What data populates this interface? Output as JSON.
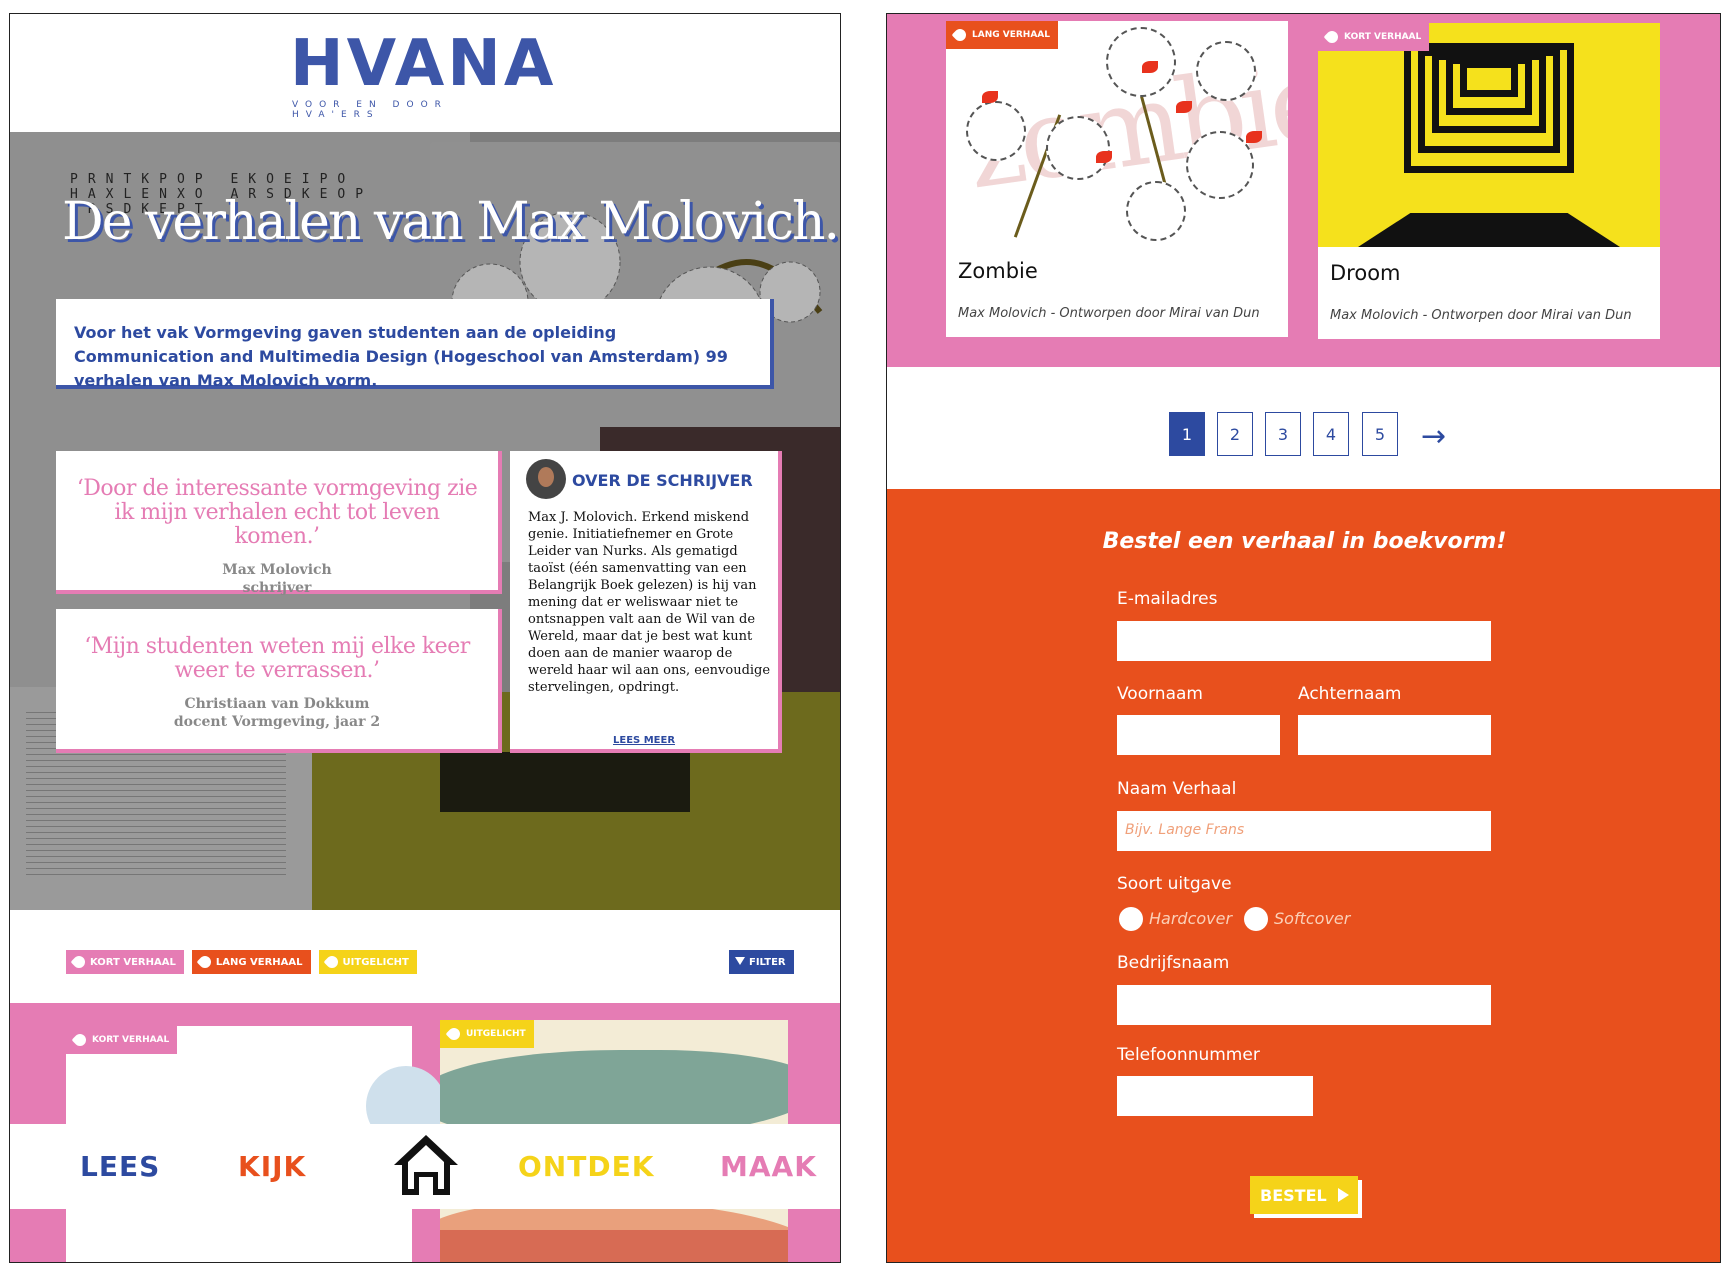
{
  "left": {
    "logo": {
      "text": "HVANA",
      "subtitle": "VOOR EN DOOR HVA'ERS"
    },
    "hero": {
      "title": "De verhalen van Max Molovich."
    },
    "intro": "Voor het vak Vormgeving gaven studenten aan de opleiding Communication and Multimedia Design (Hogeschool van Amsterdam) 99 verhalen van Max Molovich vorm.",
    "quotes": [
      {
        "text": "‘Door de interessante vormgeving zie ik mijn verhalen echt tot leven komen.’",
        "author": "Max Molovich",
        "role": "schrijver"
      },
      {
        "text": "‘Mijn studenten weten mij elke keer weer te verrassen.’",
        "author": "Christiaan van Dokkum",
        "role": "docent Vormgeving, jaar 2"
      }
    ],
    "about": {
      "heading": "OVER DE SCHRIJVER",
      "body": "Max J. Molovich. Erkend miskend genie. Initiatiefnemer en Grote Leider van Nurks. Als gematigd taoïst (één samenvatting van een Belangrijk Boek gelezen) is hij van mening dat er weliswaar niet te ontsnappen valt aan de Wil van de Wereld, maar dat je best wat kunt doen aan de manier waarop de wereld haar wil aan ons, eenvoudige stervelingen, opdringt.",
      "link": "LEES MEER"
    },
    "tags": [
      "KORT VERHAAL",
      "LANG VERHAAL",
      "UITGELICHT"
    ],
    "filter": "FILTER",
    "card_tags": [
      "KORT VERHAAL",
      "UITGELICHT"
    ],
    "nav": {
      "lees": "LEES",
      "kijk": "KIJK",
      "ontdek": "ONTDEK",
      "maak": "MAAK"
    },
    "colors": {
      "blue": "#2d4aa0",
      "pink": "#e57cb4",
      "orange": "#e8501d",
      "yellow": "#f5d319"
    }
  },
  "right": {
    "cards": [
      {
        "tag": "LANG VERHAAL",
        "title": "Zombie",
        "subtitle": "Max Molovich - Ontworpen door Mirai van Dun"
      },
      {
        "tag": "KORT VERHAAL",
        "title": "Droom",
        "subtitle": "Max Molovich - Ontworpen door Mirai van Dun"
      }
    ],
    "pagination": {
      "pages": [
        "1",
        "2",
        "3",
        "4",
        "5"
      ],
      "active": "1",
      "next": "→"
    },
    "form": {
      "heading": "Bestel een verhaal in boekvorm!",
      "email_label": "E-mailadres",
      "first_name_label": "Voornaam",
      "last_name_label": "Achternaam",
      "story_label": "Naam Verhaal",
      "story_placeholder": "Bijv. Lange Frans",
      "edition_label": "Soort uitgave",
      "edition_options": [
        "Hardcover",
        "Softcover"
      ],
      "company_label": "Bedrijfsnaam",
      "phone_label": "Telefoonnummer",
      "submit": "BESTEL"
    }
  }
}
